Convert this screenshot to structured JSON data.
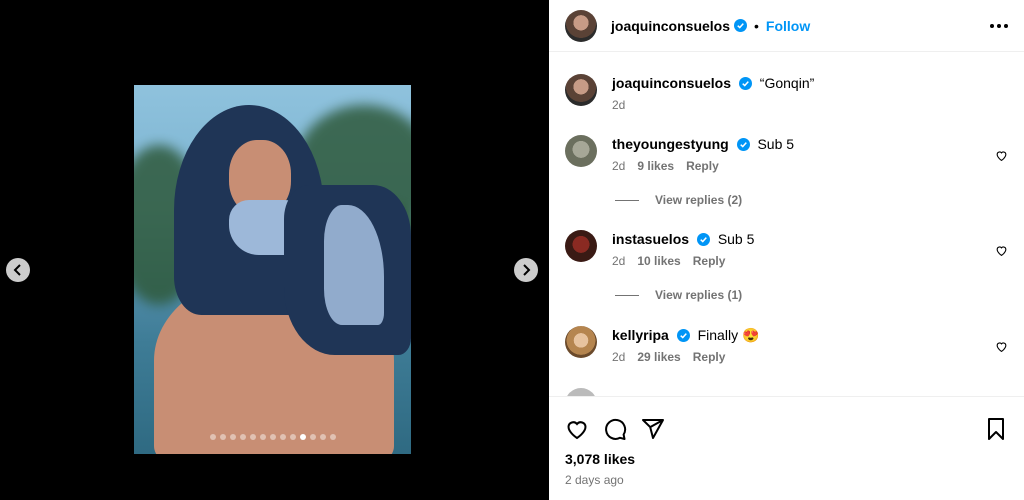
{
  "post": {
    "author": "joaquinconsuelos",
    "follow_label": "Follow",
    "separator": "•",
    "caption": "“Gonqin”",
    "caption_age": "2d",
    "likes": "3,078 likes",
    "posted": "2 days ago"
  },
  "carousel": {
    "total_slides": 13,
    "active_index": 9
  },
  "comments": [
    {
      "user": "theyoungestyung",
      "text": "Sub 5",
      "age": "2d",
      "likes": "9 likes",
      "reply_label": "Reply",
      "replies_label": "View replies (2)"
    },
    {
      "user": "instasuelos",
      "text": "Sub 5",
      "age": "2d",
      "likes": "10 likes",
      "reply_label": "Reply",
      "replies_label": "View replies (1)"
    },
    {
      "user": "kellyripa",
      "text": "Finally 😍",
      "age": "2d",
      "likes": "29 likes",
      "reply_label": "Reply"
    }
  ],
  "colors": {
    "accent": "#0095f6",
    "verified": "#0095f6",
    "muted": "#737373"
  },
  "icons": [
    "chevron-left-icon",
    "chevron-right-icon",
    "verified-icon",
    "more-icon",
    "heart-icon",
    "comment-icon",
    "share-icon",
    "bookmark-icon"
  ]
}
